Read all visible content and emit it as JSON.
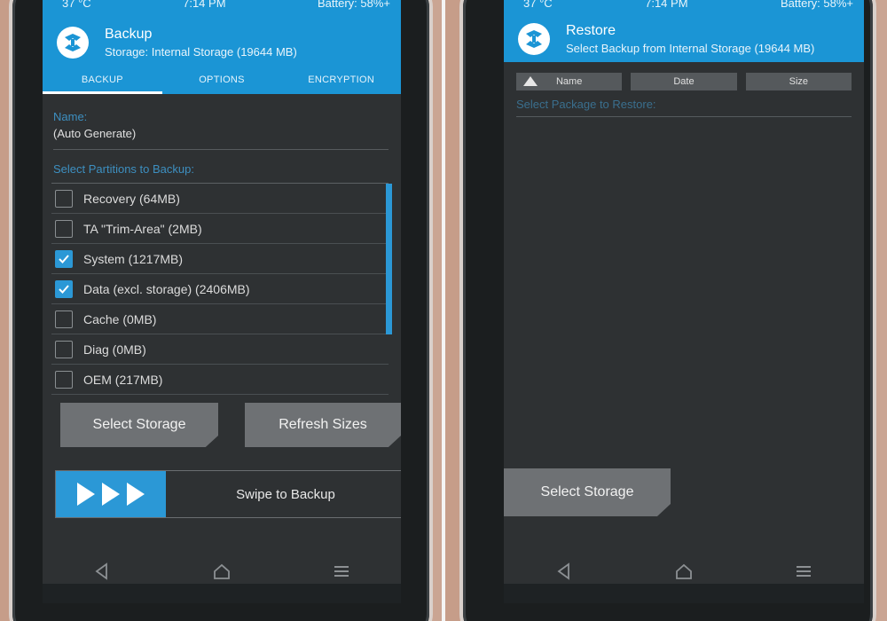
{
  "left": {
    "status": {
      "temp": "37 °C",
      "time": "7:14 PM",
      "battery": "Battery: 58%+"
    },
    "header": {
      "title": "Backup",
      "subtitle": "Storage: Internal Storage (19644 MB)"
    },
    "tabs": [
      "BACKUP",
      "OPTIONS",
      "ENCRYPTION"
    ],
    "active_tab": "BACKUP",
    "name_label": "Name:",
    "name_value": "(Auto Generate)",
    "partitions_label": "Select Partitions to Backup:",
    "partitions": [
      {
        "label": "Recovery (64MB)",
        "checked": false
      },
      {
        "label": "TA \"Trim-Area\" (2MB)",
        "checked": false
      },
      {
        "label": "System (1217MB)",
        "checked": true
      },
      {
        "label": "Data (excl. storage) (2406MB)",
        "checked": true
      },
      {
        "label": "Cache (0MB)",
        "checked": false
      },
      {
        "label": "Diag (0MB)",
        "checked": false
      },
      {
        "label": "OEM (217MB)",
        "checked": false
      }
    ],
    "buttons": {
      "select_storage": "Select Storage",
      "refresh_sizes": "Refresh Sizes"
    },
    "swipe_label": "Swipe to Backup"
  },
  "right": {
    "status": {
      "temp": "37 °C",
      "time": "7:14 PM",
      "battery": "Battery: 58%+"
    },
    "header": {
      "title": "Restore",
      "subtitle": "Select Backup from Internal Storage (19644 MB)"
    },
    "sort": {
      "name": "Name",
      "date": "Date",
      "size": "Size"
    },
    "package_label": "Select Package to Restore:",
    "buttons": {
      "select_storage": "Select Storage"
    }
  },
  "colors": {
    "accent": "#1b95d5",
    "background": "#2e3133",
    "button": "#6e7174"
  },
  "icons": [
    "teamwin-logo-icon",
    "checkbox-icon",
    "back-icon",
    "home-icon",
    "menu-icon",
    "sort-ascending-icon"
  ]
}
